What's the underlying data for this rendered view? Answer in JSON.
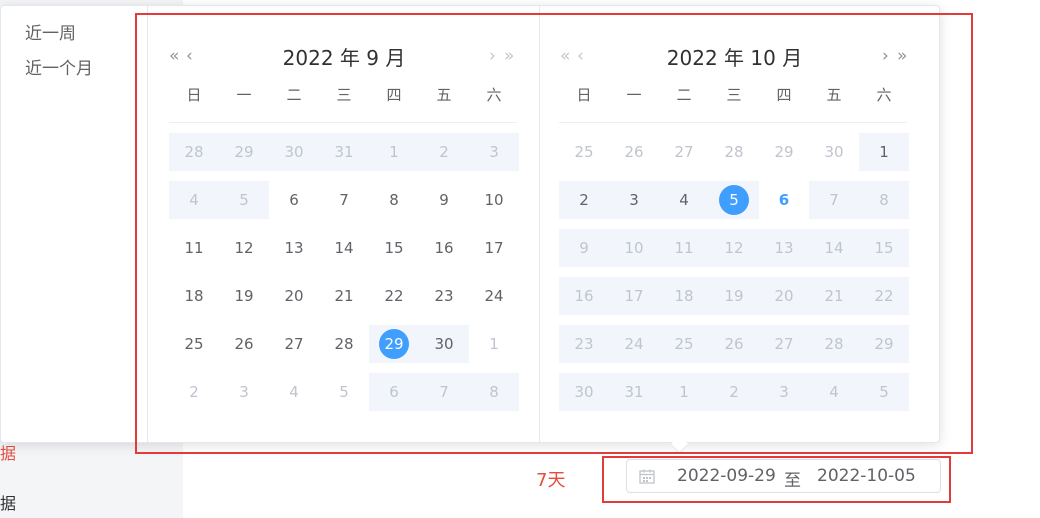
{
  "left_menu": {
    "item_red": "数据",
    "item_dark": "数据"
  },
  "shortcuts": [
    "近一周",
    "近一个月"
  ],
  "calendar": {
    "weekdays": [
      "日",
      "一",
      "二",
      "三",
      "四",
      "五",
      "六"
    ],
    "left": {
      "title": "2022 年 9 月",
      "prev_year": "«",
      "prev_month": "‹",
      "next_month": "›",
      "next_year": "»",
      "weeks": [
        [
          {
            "d": "28",
            "m": 1,
            "r": 1
          },
          {
            "d": "29",
            "m": 1,
            "r": 1
          },
          {
            "d": "30",
            "m": 1,
            "r": 1
          },
          {
            "d": "31",
            "m": 1,
            "r": 1
          },
          {
            "d": "1",
            "m": 1,
            "r": 1
          },
          {
            "d": "2",
            "m": 1,
            "r": 1
          },
          {
            "d": "3",
            "m": 1,
            "r": 1
          }
        ],
        [
          {
            "d": "4",
            "m": 1,
            "r": 1
          },
          {
            "d": "5",
            "m": 1,
            "r": 1
          },
          {
            "d": "6"
          },
          {
            "d": "7"
          },
          {
            "d": "8"
          },
          {
            "d": "9"
          },
          {
            "d": "10"
          }
        ],
        [
          {
            "d": "11"
          },
          {
            "d": "12"
          },
          {
            "d": "13"
          },
          {
            "d": "14"
          },
          {
            "d": "15"
          },
          {
            "d": "16"
          },
          {
            "d": "17"
          }
        ],
        [
          {
            "d": "18"
          },
          {
            "d": "19"
          },
          {
            "d": "20"
          },
          {
            "d": "21"
          },
          {
            "d": "22"
          },
          {
            "d": "23"
          },
          {
            "d": "24"
          }
        ],
        [
          {
            "d": "25"
          },
          {
            "d": "26"
          },
          {
            "d": "27"
          },
          {
            "d": "28"
          },
          {
            "d": "29",
            "sel": 1,
            "r": 1
          },
          {
            "d": "30",
            "r": 1
          },
          {
            "d": "1",
            "m": 1
          }
        ],
        [
          {
            "d": "2",
            "m": 1
          },
          {
            "d": "3",
            "m": 1
          },
          {
            "d": "4",
            "m": 1
          },
          {
            "d": "5",
            "m": 1
          },
          {
            "d": "6",
            "m": 1,
            "r": 1
          },
          {
            "d": "7",
            "m": 1,
            "r": 1
          },
          {
            "d": "8",
            "m": 1,
            "r": 1
          }
        ]
      ]
    },
    "right": {
      "title": "2022 年 10 月",
      "prev_year": "«",
      "prev_month": "‹",
      "next_month": "›",
      "next_year": "»",
      "weeks": [
        [
          {
            "d": "25",
            "m": 1
          },
          {
            "d": "26",
            "m": 1
          },
          {
            "d": "27",
            "m": 1
          },
          {
            "d": "28",
            "m": 1
          },
          {
            "d": "29",
            "m": 1
          },
          {
            "d": "30",
            "m": 1
          },
          {
            "d": "1",
            "r": 1
          }
        ],
        [
          {
            "d": "2",
            "r": 1
          },
          {
            "d": "3",
            "r": 1
          },
          {
            "d": "4",
            "r": 1
          },
          {
            "d": "5",
            "sel": 1,
            "r": 1
          },
          {
            "d": "6",
            "today": 1
          },
          {
            "d": "7",
            "m": 1,
            "r": 1
          },
          {
            "d": "8",
            "m": 1,
            "r": 1
          }
        ],
        [
          {
            "d": "9",
            "m": 1,
            "r": 1
          },
          {
            "d": "10",
            "m": 1,
            "r": 1
          },
          {
            "d": "11",
            "m": 1,
            "r": 1
          },
          {
            "d": "12",
            "m": 1,
            "r": 1
          },
          {
            "d": "13",
            "m": 1,
            "r": 1
          },
          {
            "d": "14",
            "m": 1,
            "r": 1
          },
          {
            "d": "15",
            "m": 1,
            "r": 1
          }
        ],
        [
          {
            "d": "16",
            "m": 1,
            "r": 1
          },
          {
            "d": "17",
            "m": 1,
            "r": 1
          },
          {
            "d": "18",
            "m": 1,
            "r": 1
          },
          {
            "d": "19",
            "m": 1,
            "r": 1
          },
          {
            "d": "20",
            "m": 1,
            "r": 1
          },
          {
            "d": "21",
            "m": 1,
            "r": 1
          },
          {
            "d": "22",
            "m": 1,
            "r": 1
          }
        ],
        [
          {
            "d": "23",
            "m": 1,
            "r": 1
          },
          {
            "d": "24",
            "m": 1,
            "r": 1
          },
          {
            "d": "25",
            "m": 1,
            "r": 1
          },
          {
            "d": "26",
            "m": 1,
            "r": 1
          },
          {
            "d": "27",
            "m": 1,
            "r": 1
          },
          {
            "d": "28",
            "m": 1,
            "r": 1
          },
          {
            "d": "29",
            "m": 1,
            "r": 1
          }
        ],
        [
          {
            "d": "30",
            "m": 1,
            "r": 1
          },
          {
            "d": "31",
            "m": 1,
            "r": 1
          },
          {
            "d": "1",
            "m": 1,
            "r": 1
          },
          {
            "d": "2",
            "m": 1,
            "r": 1
          },
          {
            "d": "3",
            "m": 1,
            "r": 1
          },
          {
            "d": "4",
            "m": 1,
            "r": 1
          },
          {
            "d": "5",
            "m": 1,
            "r": 1
          }
        ]
      ]
    }
  },
  "range_label": "7天",
  "range_input": {
    "start": "2022-09-29",
    "separator": "至",
    "end": "2022-10-05",
    "icon": "calendar-icon"
  },
  "colors": {
    "accent": "#409eff",
    "annotation": "#e33a3a",
    "label_red": "#e64d3d"
  }
}
